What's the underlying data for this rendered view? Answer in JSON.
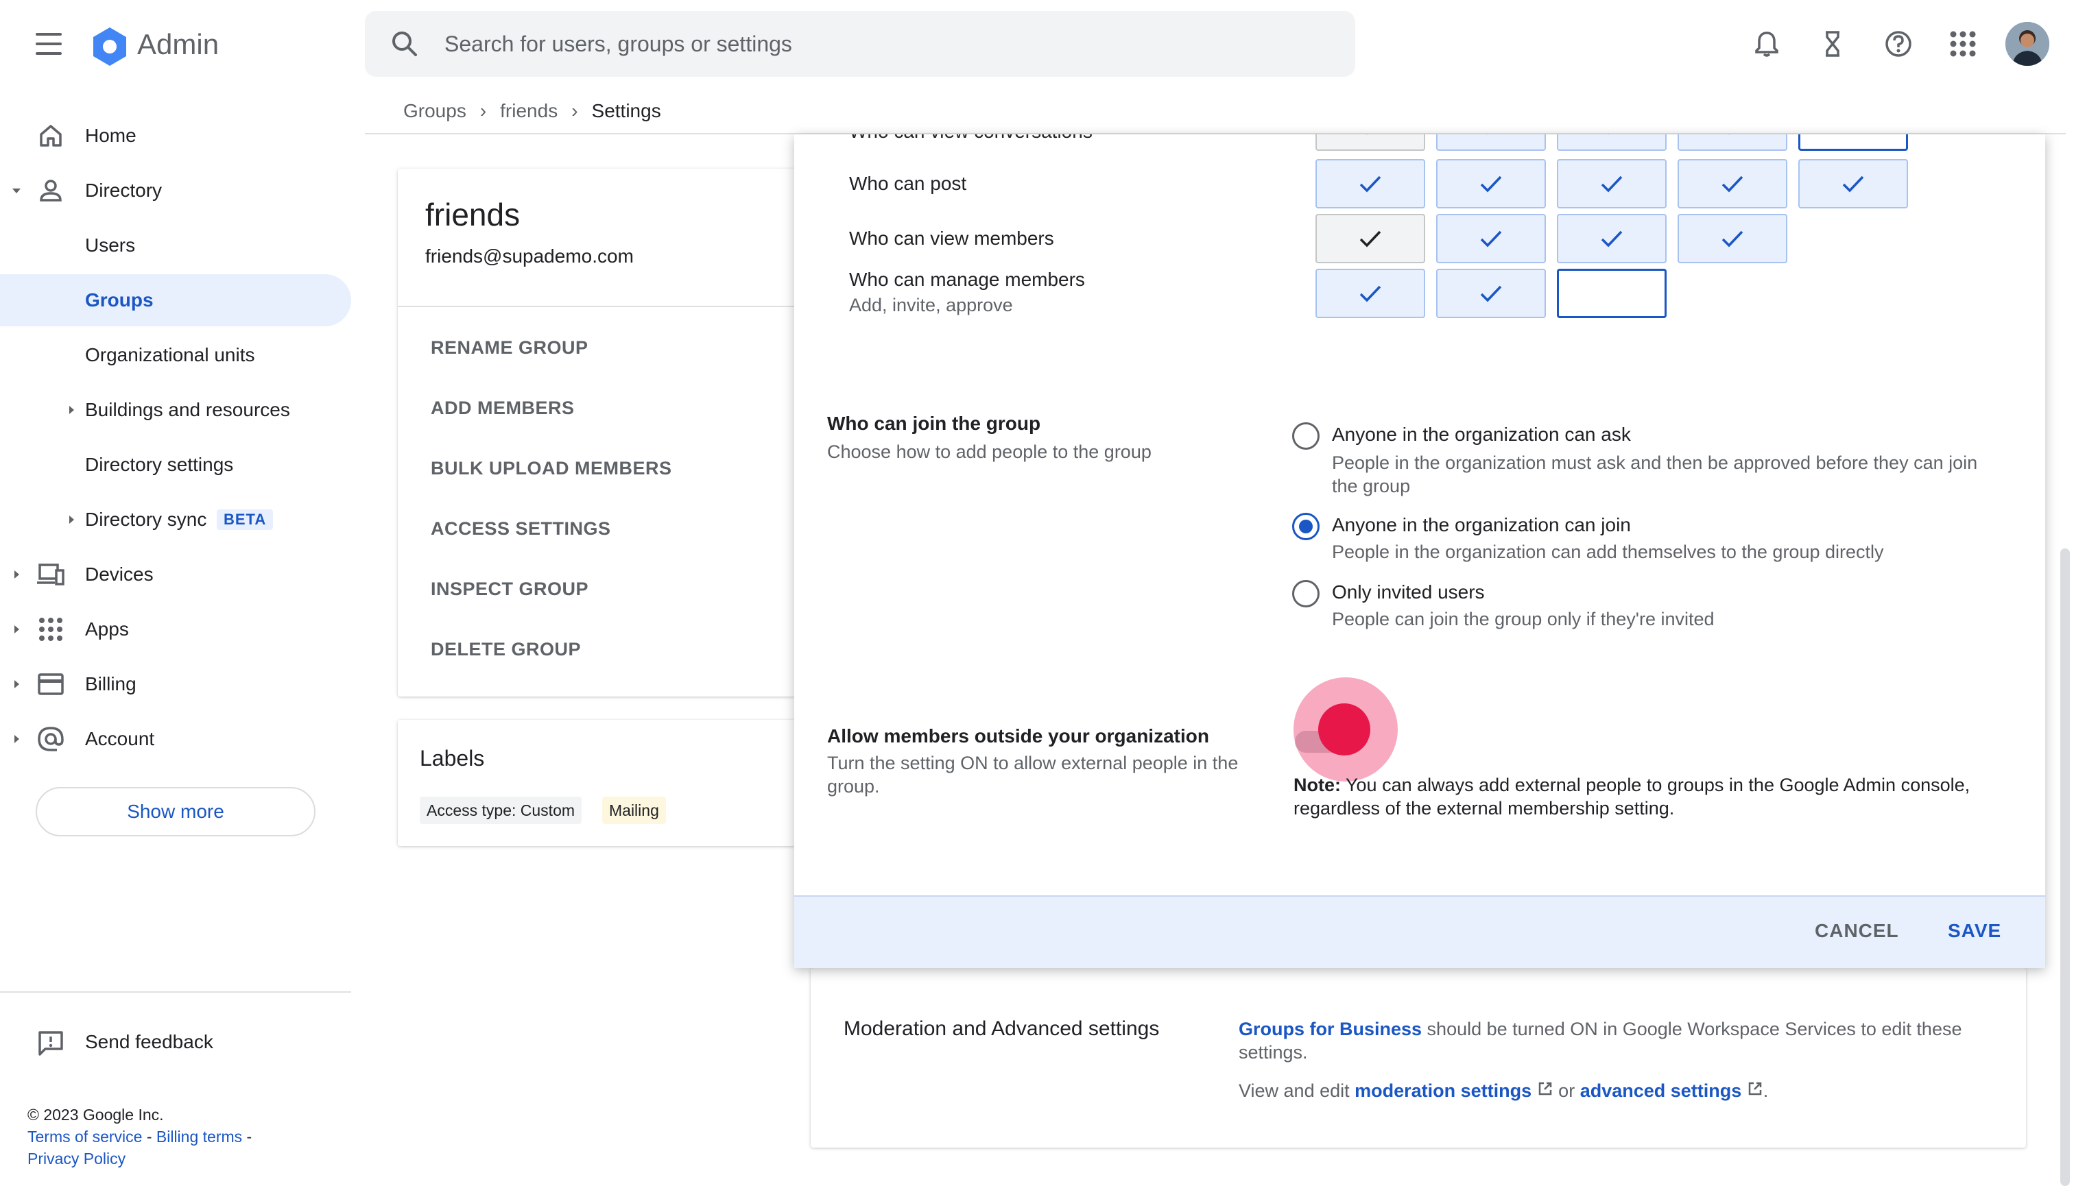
{
  "app": {
    "title": "Admin"
  },
  "search": {
    "placeholder": "Search for users, groups or settings"
  },
  "breadcrumb": {
    "items": [
      "Groups",
      "friends",
      "Settings"
    ]
  },
  "sidebar": {
    "items": [
      {
        "label": "Home",
        "icon": "home-icon"
      },
      {
        "label": "Directory",
        "icon": "person-icon"
      },
      {
        "label": "Users"
      },
      {
        "label": "Groups"
      },
      {
        "label": "Organizational units"
      },
      {
        "label": "Buildings and resources"
      },
      {
        "label": "Directory settings"
      },
      {
        "label": "Directory sync",
        "badge": "BETA"
      },
      {
        "label": "Devices",
        "icon": "devices-icon"
      },
      {
        "label": "Apps",
        "icon": "apps-grid-icon"
      },
      {
        "label": "Billing",
        "icon": "credit-card-icon"
      },
      {
        "label": "Account",
        "icon": "at-sign-icon"
      }
    ],
    "show_more": "Show more",
    "feedback": "Send feedback",
    "footer": {
      "copyright": "© 2023 Google Inc.",
      "terms": "Terms of service",
      "billing_terms": "Billing terms",
      "privacy": "Privacy Policy",
      "sep": " - "
    }
  },
  "group": {
    "name": "friends",
    "email": "friends@supademo.com",
    "actions": [
      "RENAME GROUP",
      "ADD MEMBERS",
      "BULK UPLOAD MEMBERS",
      "ACCESS SETTINGS",
      "INSPECT GROUP",
      "DELETE GROUP"
    ]
  },
  "labels": {
    "title": "Labels",
    "chips": [
      "Access type: Custom",
      "Mailing"
    ],
    "chip_colors": [
      "#f1f3f4",
      "#fef7e0"
    ]
  },
  "dialog": {
    "permissions": {
      "partial_row_label": "Who can view conversations",
      "rows": [
        {
          "label": "Who can post",
          "sub": ""
        },
        {
          "label": "Who can view members",
          "sub": ""
        },
        {
          "label": "Who can manage members",
          "sub": "Add, invite, approve"
        }
      ]
    },
    "join": {
      "title": "Who can join the group",
      "subtitle": "Choose how to add people to the group",
      "options": [
        {
          "label": "Anyone in the organization can ask",
          "desc": "People in the organization must ask and then be approved before they can join the group",
          "selected": false
        },
        {
          "label": "Anyone in the organization can join",
          "desc": "People in the organization can add themselves to the group directly",
          "selected": true
        },
        {
          "label": "Only invited users",
          "desc": "People can join the group only if they're invited",
          "selected": false
        }
      ]
    },
    "external": {
      "title": "Allow members outside your organization",
      "subtitle": "Turn the setting ON to allow external people in the group.",
      "note_label": "Note:",
      "note_text": " You can always add external people to groups in the Google Admin console, regardless of the external membership setting.",
      "toggle_on": false
    },
    "buttons": {
      "cancel": "CANCEL",
      "save": "SAVE"
    }
  },
  "moderation": {
    "title": "Moderation and Advanced settings",
    "link1": "Groups for Business",
    "text1": " should be turned ON in Google Workspace Services to edit these settings.",
    "text2": "View and edit ",
    "link2": "moderation settings",
    "text3": " or ",
    "link3": "advanced settings",
    "text4": "."
  },
  "colors": {
    "accent": "#1a56c4",
    "click_marker": "#e8174a"
  }
}
